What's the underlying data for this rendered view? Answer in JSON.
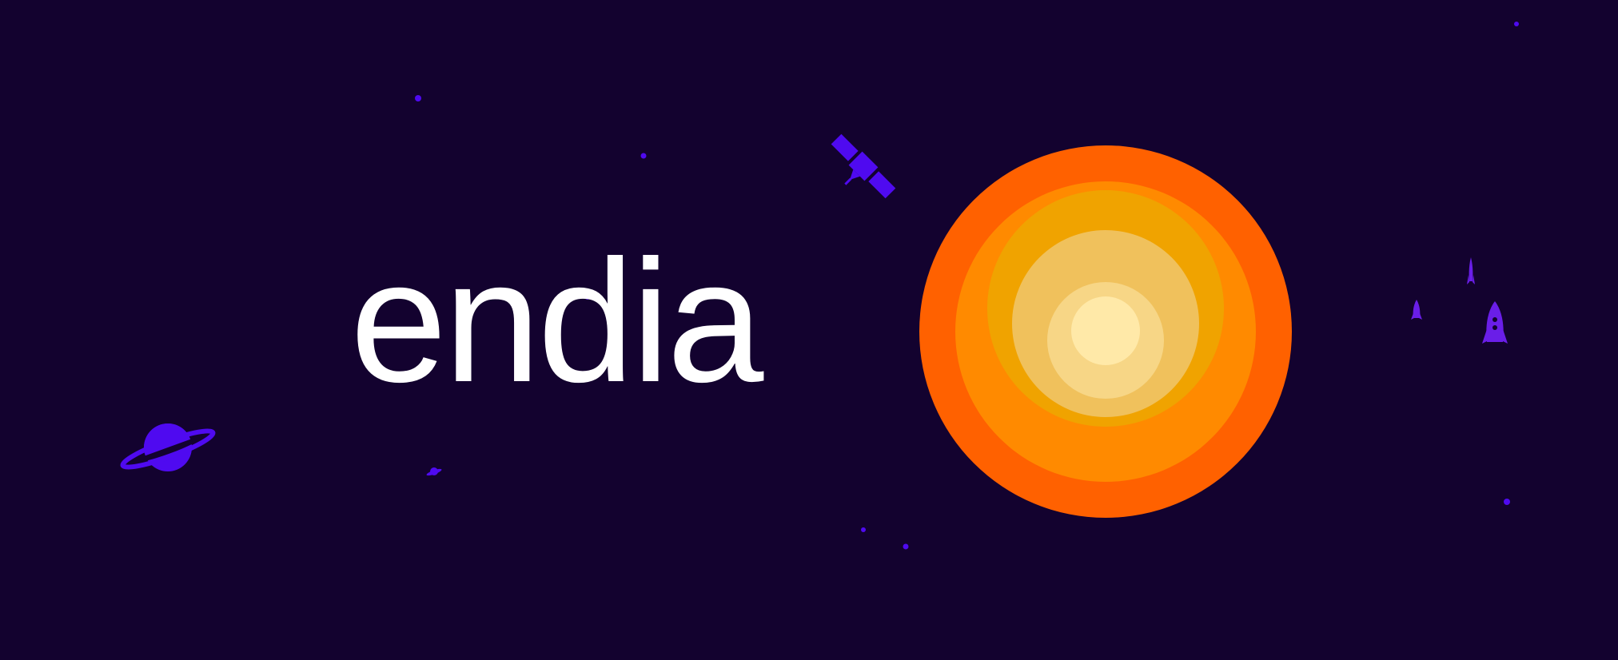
{
  "brand": {
    "wordmark": "endia"
  },
  "colors": {
    "background": "#13022f",
    "wordmark": "#ffffff",
    "accent_purple": "#4f0af0",
    "rocket_purple": "#6a1ee8",
    "sun_outer": "#ff6100",
    "sun_ring_2": "#ff8a00",
    "sun_ring_3": "#f0a300",
    "sun_ring_4": "#f0c15c",
    "sun_ring_5": "#f7d686",
    "sun_core": "#ffe9a8"
  },
  "decorations": {
    "icons": [
      "planet-icon",
      "small-planet-icon",
      "satellite-icon",
      "sun-icon",
      "rocket-icon",
      "small-rocket-icon",
      "tiny-rocket-icon",
      "star-icon"
    ]
  }
}
